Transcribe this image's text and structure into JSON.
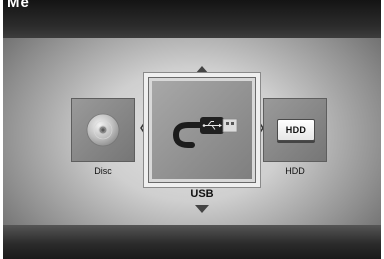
{
  "header": {
    "title": "Me"
  },
  "devices": {
    "disc": {
      "label": "Disc",
      "icon": "disc-icon"
    },
    "usb": {
      "label": "USB",
      "icon": "usb-plug-icon",
      "selected": true
    },
    "hdd": {
      "label": "HDD",
      "badge": "HDD",
      "icon": "hdd-icon"
    }
  },
  "navigation": {
    "up": "arrow-up-icon",
    "down": "arrow-down-icon",
    "left": "arrow-left-icon",
    "right": "arrow-right-icon"
  }
}
